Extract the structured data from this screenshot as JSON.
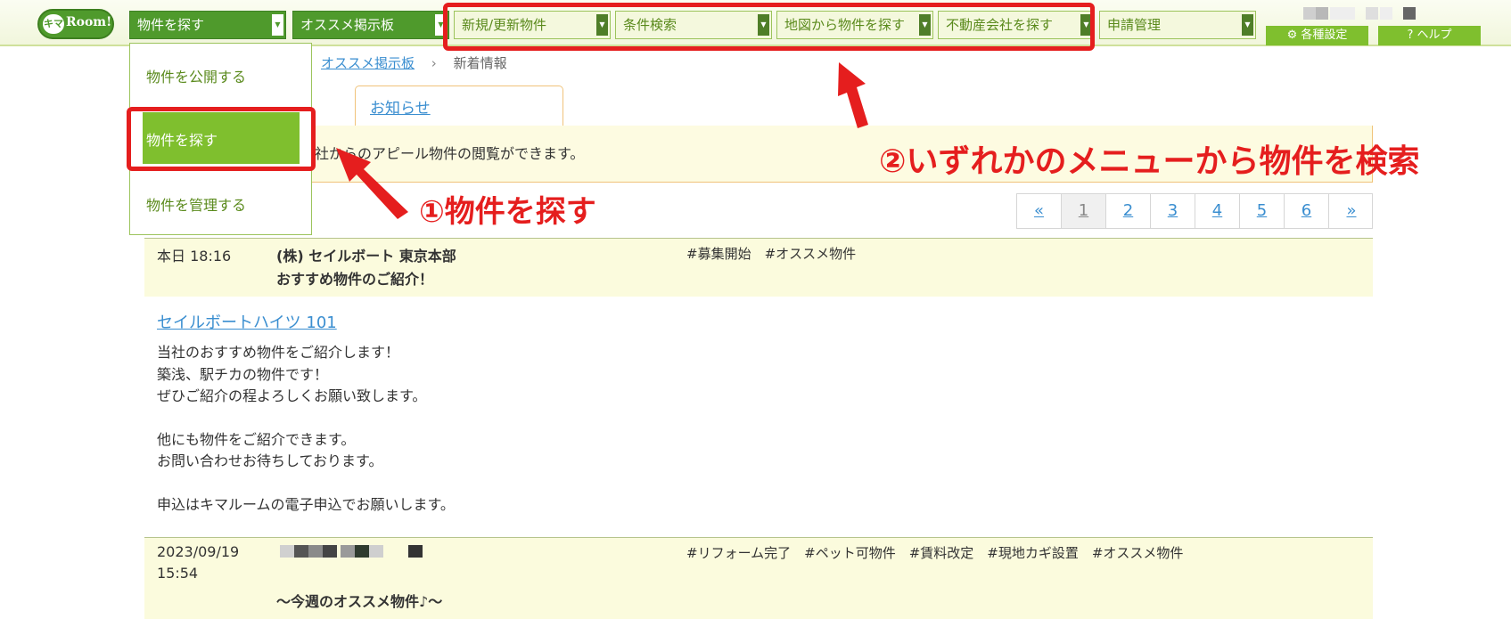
{
  "header": {
    "logo_text": "キマRoom!",
    "menus": [
      {
        "label": "物件を探す",
        "style": "dark"
      },
      {
        "label": "オススメ掲示板",
        "style": "dark"
      },
      {
        "label": "新規/更新物件",
        "style": "light"
      },
      {
        "label": "条件検索",
        "style": "light"
      },
      {
        "label": "地図から物件を探す",
        "style": "light"
      },
      {
        "label": "不動産会社を探す",
        "style": "light"
      },
      {
        "label": "申請管理",
        "style": "light"
      }
    ],
    "settings_label": "各種設定",
    "help_label": "ヘルプ"
  },
  "dropdown": {
    "items": [
      "物件を公開する",
      "物件を探す",
      "物件を管理する"
    ],
    "active_index": 1
  },
  "breadcrumb": {
    "link": "オススメ掲示板",
    "separator": "›",
    "current": "新着情報"
  },
  "tabs": {
    "notice_tab": "お知らせ"
  },
  "notice_text": "社からのアピール物件の閲覧ができます。",
  "annotations": {
    "step1": "①物件を探す",
    "step2": "②いずれかのメニューから物件を検索"
  },
  "pager": [
    "«",
    "1",
    "2",
    "3",
    "4",
    "5",
    "6",
    "»"
  ],
  "posts": [
    {
      "date": "本日 18:16",
      "company": "(株) セイルボート 東京本部",
      "tags": "#募集開始　#オススメ物件",
      "title": "おすすめ物件のご紹介！",
      "property_link": "セイルボートハイツ 101",
      "body": [
        "当社のおすすめ物件をご紹介します！",
        "築浅、駅チカの物件です！",
        "ぜひご紹介の程よろしくお願い致します。",
        "",
        "他にも物件をご紹介できます。",
        "お問い合わせお待ちしております。",
        "",
        "申込はキマルームの電子申込でお願いします。"
      ]
    },
    {
      "date_line1": "2023/09/19",
      "date_line2": "15:54",
      "tags": "#リフォーム完了　#ペット可物件　#賃料改定　#現地カギ設置　#オススメ物件",
      "title": "～今週のオススメ物件♪～"
    }
  ],
  "colors": {
    "brand_green": "#4f9a2c",
    "accent_green": "#7fbf2e",
    "callout_red": "#e51e1e",
    "link_blue": "#3a8ed0"
  }
}
